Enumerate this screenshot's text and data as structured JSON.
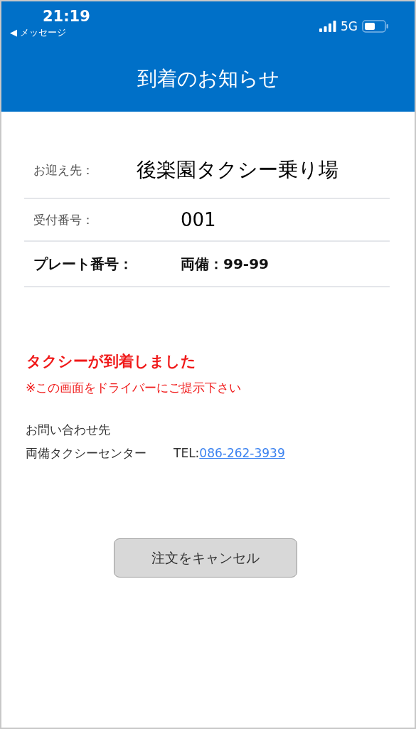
{
  "status_bar": {
    "time": "21:19",
    "back_label": "◀ メッセージ",
    "network": "5G"
  },
  "header": {
    "title": "到着のお知らせ"
  },
  "details": [
    {
      "kind": "large",
      "label": "お迎え先：",
      "value": "後楽園タクシー乗り場"
    },
    {
      "kind": "normal",
      "label": "受付番号：",
      "value": "001"
    },
    {
      "kind": "bold",
      "label": "プレート番号：",
      "value": "両備：99-99"
    }
  ],
  "notice": {
    "title": "タクシーが到着しました",
    "note": "※この画面をドライバーにご提示下さい"
  },
  "contact": {
    "heading": "お問い合わせ先",
    "name": "両備タクシーセンター",
    "tel_label": "TEL:",
    "tel": "086-262-3939"
  },
  "cancel_button": "注文をキャンセル"
}
